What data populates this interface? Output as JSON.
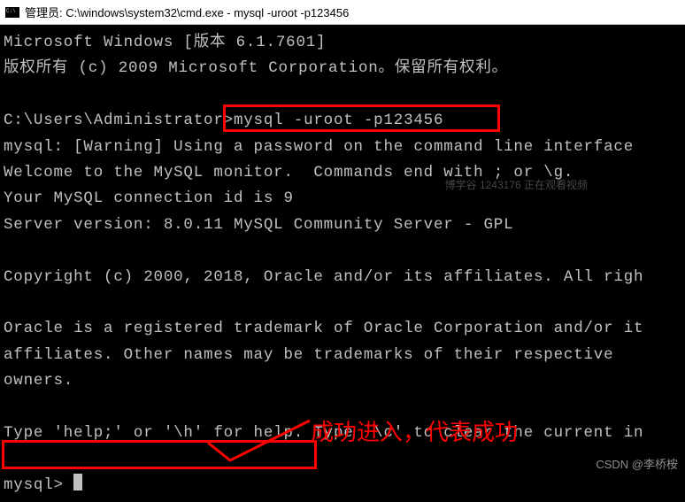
{
  "titlebar": {
    "text": "管理员: C:\\windows\\system32\\cmd.exe - mysql  -uroot -p123456"
  },
  "terminal": {
    "line1": "Microsoft Windows [版本 6.1.7601]",
    "line2": "版权所有 (c) 2009 Microsoft Corporation。保留所有权利。",
    "blank1": "",
    "prompt1_path": "C:\\Users\\Administrator>",
    "prompt1_cmd": "mysql -uroot -p123456",
    "line4": "mysql: [Warning] Using a password on the command line interface ",
    "line5": "Welcome to the MySQL monitor.  Commands end with ; or \\g.",
    "line6": "Your MySQL connection id is 9",
    "line7": "Server version: 8.0.11 MySQL Community Server - GPL",
    "blank2": "",
    "line8": "Copyright (c) 2000, 2018, Oracle and/or its affiliates. All righ",
    "blank3": "",
    "line9": "Oracle is a registered trademark of Oracle Corporation and/or it",
    "line10": "affiliates. Other names may be trademarks of their respective",
    "line11": "owners.",
    "blank4": "",
    "line12": "Type 'help;' or '\\h' for help. Type '\\c' to clear the current in",
    "blank5": "",
    "prompt2": "mysql> "
  },
  "annotations": {
    "success_text": "成功进入，代表成功"
  },
  "watermarks": {
    "top": "博学谷 1243176 正在观看视频",
    "bottom": "CSDN @李桥桉"
  }
}
